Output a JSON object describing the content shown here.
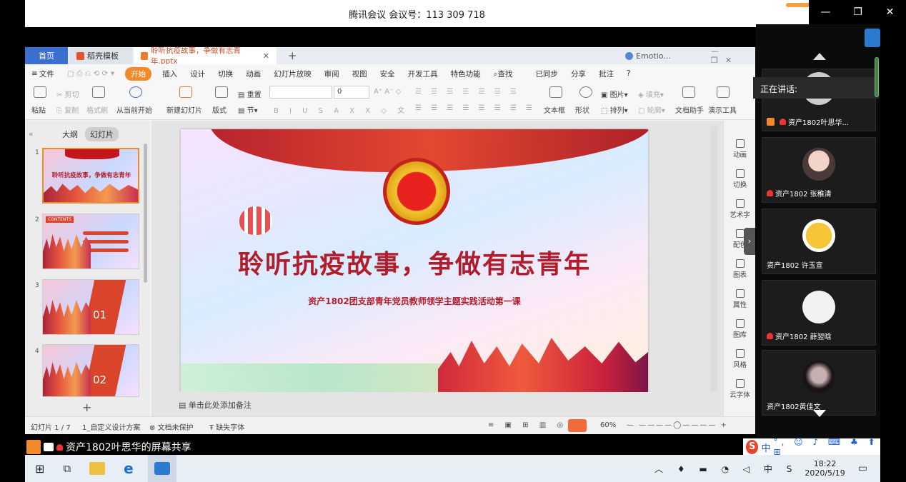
{
  "meeting": {
    "title": "腾讯会议 会议号：113 309 718",
    "window_controls": [
      "—",
      "❐",
      "✕"
    ],
    "speaking_label": "正在讲话:",
    "share_status": "资产1802叶思华的屏幕共享"
  },
  "wps": {
    "tabs": [
      {
        "label": "首页"
      },
      {
        "label": "稻壳模板"
      },
      {
        "label": "聆听抗疫故事，争做有志青年.pptx"
      }
    ],
    "account": "Emotio...",
    "menu": [
      "文件",
      "开始",
      "插入",
      "设计",
      "切换",
      "动画",
      "幻灯片放映",
      "审阅",
      "视图",
      "安全",
      "开发工具",
      "特色功能",
      "查找",
      "已同步",
      "分享",
      "批注"
    ],
    "ribbon": {
      "paste": "粘贴",
      "cut": "剪切",
      "copy": "复制",
      "format_painter": "格式刷",
      "play_from_current": "从当前开始",
      "new_slide": "新建幻灯片",
      "layout": "版式",
      "reset": "重置",
      "section": "节",
      "font_size": "0",
      "textbox": "文本框",
      "shape": "形状",
      "picture": "图片",
      "arrange": "排列",
      "fill": "填充",
      "outline": "轮廓",
      "doc_helper": "文档助手",
      "presenter_tools": "演示工具"
    },
    "pane_tabs": [
      "大纲",
      "幻灯片"
    ],
    "thumb1_title": "聆听抗疫故事，争做有志青年",
    "thumb2_label": "CONTENTS",
    "thumb3_num": "01",
    "thumb4_num": "02",
    "slide": {
      "title": "聆听抗疫故事，争做有志青年",
      "subtitle": "资产1802团支部青年党员教师领学主题实践活动第一课"
    },
    "notes_placeholder": "单击此处添加备注",
    "right_panel": [
      "动画",
      "切换",
      "艺术字",
      "配色",
      "图表",
      "属性",
      "图库",
      "风格",
      "云字体"
    ],
    "status": {
      "slide_count": "幻灯片 1 / 7",
      "theme": "1_自定义设计方案",
      "doc_protect": "文档未保护",
      "missing_font": "缺失字体",
      "zoom": "60%"
    }
  },
  "participants": [
    {
      "name": "资产1802叶思华..."
    },
    {
      "name": "资产1802 张稚清"
    },
    {
      "name": "资产1802 许玉宣"
    },
    {
      "name": "资产1802 薛翌晗"
    },
    {
      "name": "资产1802黄佳文"
    }
  ],
  "taskbar": {
    "time": "18:22",
    "date": "2020/5/19",
    "ime_label": "中"
  },
  "colors": {
    "accent_orange": "#f28a2c",
    "title_red": "#b21d2b",
    "tab_blue": "#3a6fd0"
  }
}
